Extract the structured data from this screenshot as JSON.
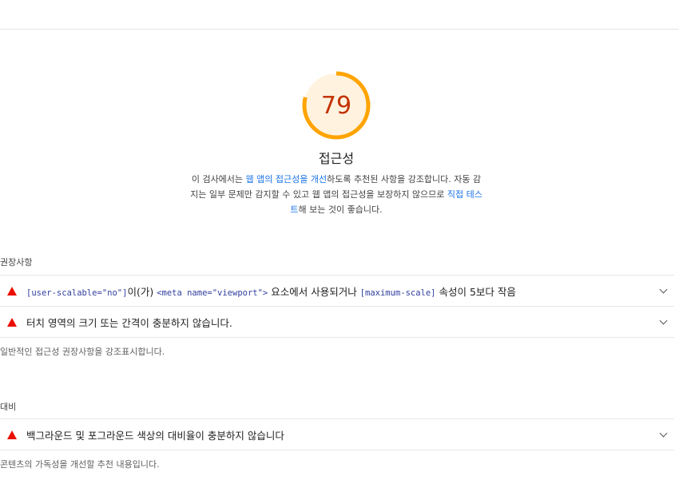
{
  "category": {
    "score": "79",
    "score_fraction": 0.79,
    "score_color": "#ffa400",
    "score_text_color": "#c33300",
    "score_bg_color": "#fff3e0",
    "title": "접근성",
    "desc_pre": "이 검사에서는 ",
    "desc_link1": "웹 앱의 접근성을 개선",
    "desc_mid": "하도록 추천된 사항을 강조합니다. 자동 감지는 일부 문제만 감지할 수 있고 웹 앱의 접근성을 보장하지 않으므로 ",
    "desc_link2": "직접 테스트",
    "desc_post": "해 보는 것이 좋습니다."
  },
  "groups": {
    "best_practices": {
      "title": "권장사항",
      "audits": [
        {
          "code1": "[user-scalable=\"no\"]",
          "text1": "이(가) ",
          "code2": "<meta name=\"viewport\">",
          "text2": " 요소에서 사용되거나 ",
          "code3": "[maximum-scale]",
          "text3": " 속성이 5보다 작음"
        },
        {
          "title": "터치 영역의 크기 또는 간격이 충분하지 않습니다."
        }
      ],
      "description": "일반적인 접근성 권장사항을 강조표시합니다."
    },
    "contrast": {
      "title": "대비",
      "audits": [
        {
          "title": "백그라운드 및 포그라운드 색상의 대비율이 충분하지 않습니다"
        }
      ],
      "description": "콘텐츠의 가독성을 개선할 추천 내용입니다."
    }
  },
  "icons": {
    "fail": "fail-triangle-icon",
    "expand": "chevron-down-icon"
  },
  "colors": {
    "fail": "#eb0f00",
    "link": "#1a73e8",
    "code": "#303f9f"
  }
}
